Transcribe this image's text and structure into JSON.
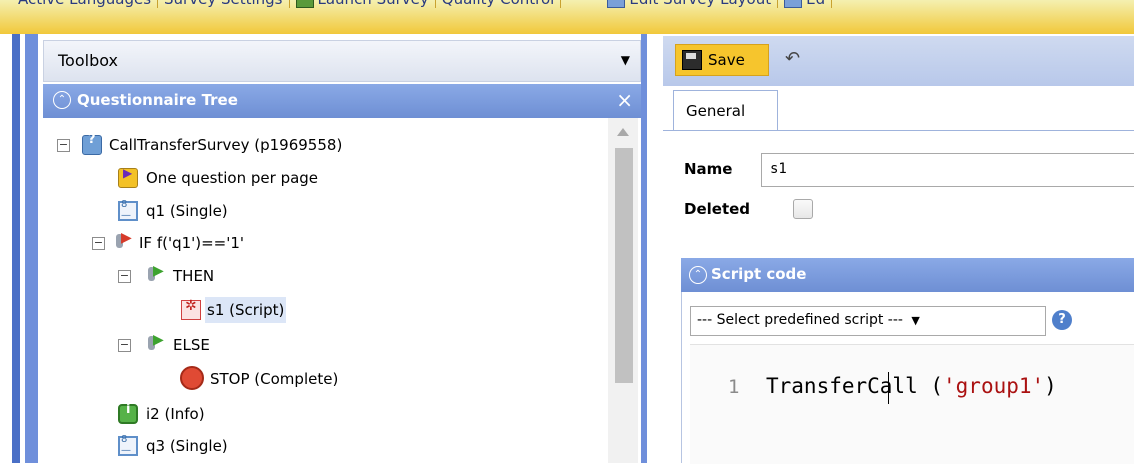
{
  "menu": {
    "items": [
      "Active Languages",
      "Survey Settings",
      "Launch Survey",
      "Quality Control",
      "Edit Survey Layout",
      "Ed"
    ]
  },
  "toolbox": {
    "title": "Toolbox"
  },
  "questionnaire_tree": {
    "title": "Questionnaire Tree",
    "nodes": [
      {
        "label": "CallTransferSurvey (p1969558)",
        "icon": "survey-icon"
      },
      {
        "label": "One question per page",
        "icon": "page-break-icon"
      },
      {
        "label": "q1 (Single)",
        "icon": "single-question-icon"
      },
      {
        "label": "IF f('q1')=='1'",
        "icon": "condition-icon"
      },
      {
        "label": "THEN",
        "icon": "then-branch-icon"
      },
      {
        "label": "s1 (Script)",
        "icon": "script-icon",
        "selected": true
      },
      {
        "label": "ELSE",
        "icon": "else-branch-icon"
      },
      {
        "label": "STOP (Complete)",
        "icon": "stop-icon"
      },
      {
        "label": "i2 (Info)",
        "icon": "info-icon"
      },
      {
        "label": "q3 (Single)",
        "icon": "single-question-icon"
      }
    ]
  },
  "editor_toolbar": {
    "save_label": "Save"
  },
  "tabs": [
    {
      "label": "General"
    }
  ],
  "form": {
    "name_label": "Name",
    "name_value": "s1",
    "deleted_label": "Deleted"
  },
  "script": {
    "title": "Script code",
    "predefined_select": "--- Select predefined script ---",
    "line_number": "1",
    "code_prefix": "TransferCall (",
    "code_string": "'group1'",
    "code_suffix": ")"
  },
  "colors": {
    "header_blue": "#7b9ad8",
    "save_yellow": "#f6c52d",
    "side_blue": "#4a6fc6"
  }
}
